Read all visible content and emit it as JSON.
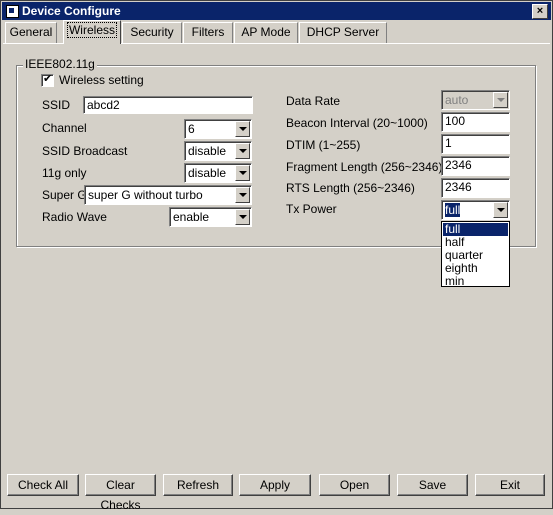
{
  "window": {
    "title": "Device Configure"
  },
  "tabs": [
    "General",
    "Wireless",
    "Security",
    "Filters",
    "AP Mode",
    "DHCP Server"
  ],
  "group": {
    "title": "IEEE802.11g",
    "wireless_setting_label": "Wireless setting",
    "wireless_setting_checked": true
  },
  "left": {
    "ssid_label": "SSID",
    "ssid_value": "abcd2",
    "channel_label": "Channel",
    "channel_value": "6",
    "ssid_broadcast_label": "SSID Broadcast",
    "ssid_broadcast_value": "disable",
    "only11g_label": "11g only",
    "only11g_value": "disable",
    "superg_label": "Super G",
    "superg_value": "super G without turbo",
    "radio_label": "Radio Wave",
    "radio_value": "enable"
  },
  "right": {
    "datarate_label": "Data Rate",
    "datarate_value": "auto",
    "beacon_label": "Beacon Interval (20~1000)",
    "beacon_value": "100",
    "dtim_label": "DTIM (1~255)",
    "dtim_value": "1",
    "fragment_label": "Fragment Length (256~2346)",
    "fragment_value": "2346",
    "rts_label": "RTS Length (256~2346)",
    "rts_value": "2346",
    "txpower_label": "Tx Power",
    "txpower_value": "full"
  },
  "txpower_options": [
    "full",
    "half",
    "quarter",
    "eighth",
    "min"
  ],
  "buttons": {
    "check_all": "Check All",
    "clear_checks": "Clear Checks",
    "refresh": "Refresh",
    "apply": "Apply",
    "open": "Open",
    "save": "Save",
    "exit": "Exit"
  },
  "colors": {
    "titlebar": "#0a246a",
    "face": "#d4d0c8",
    "selection": "#0a246a"
  }
}
